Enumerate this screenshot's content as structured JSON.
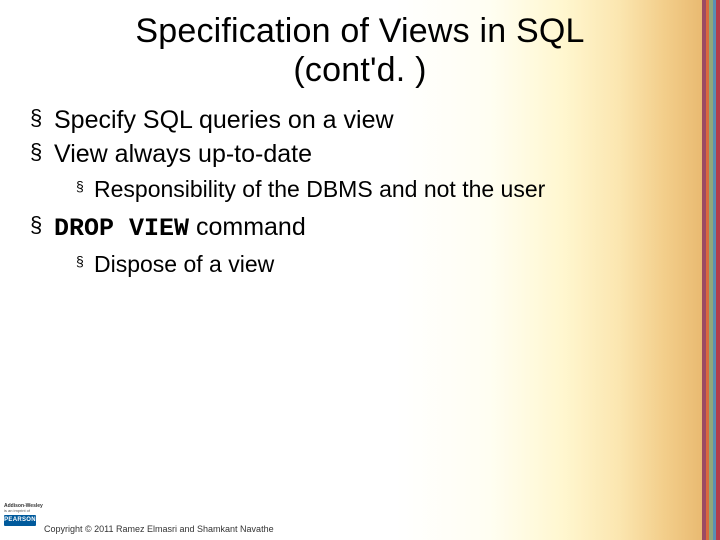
{
  "title_line1": "Specification of Views in SQL",
  "title_line2": "(cont'd. )",
  "bullets": {
    "b1": "Specify SQL queries on a view",
    "b2": "View always up-to-date",
    "b2_sub1": "Responsibility of the DBMS and not the user",
    "b3_code": "DROP VIEW",
    "b3_rest": " command",
    "b3_sub1": "Dispose of a view"
  },
  "footer": {
    "brand_top": "Addison-Wesley",
    "brand_sub": "is an imprint of",
    "brand_logo": "PEARSON",
    "copyright": "Copyright © 2011 Ramez Elmasri and Shamkant Navathe"
  }
}
